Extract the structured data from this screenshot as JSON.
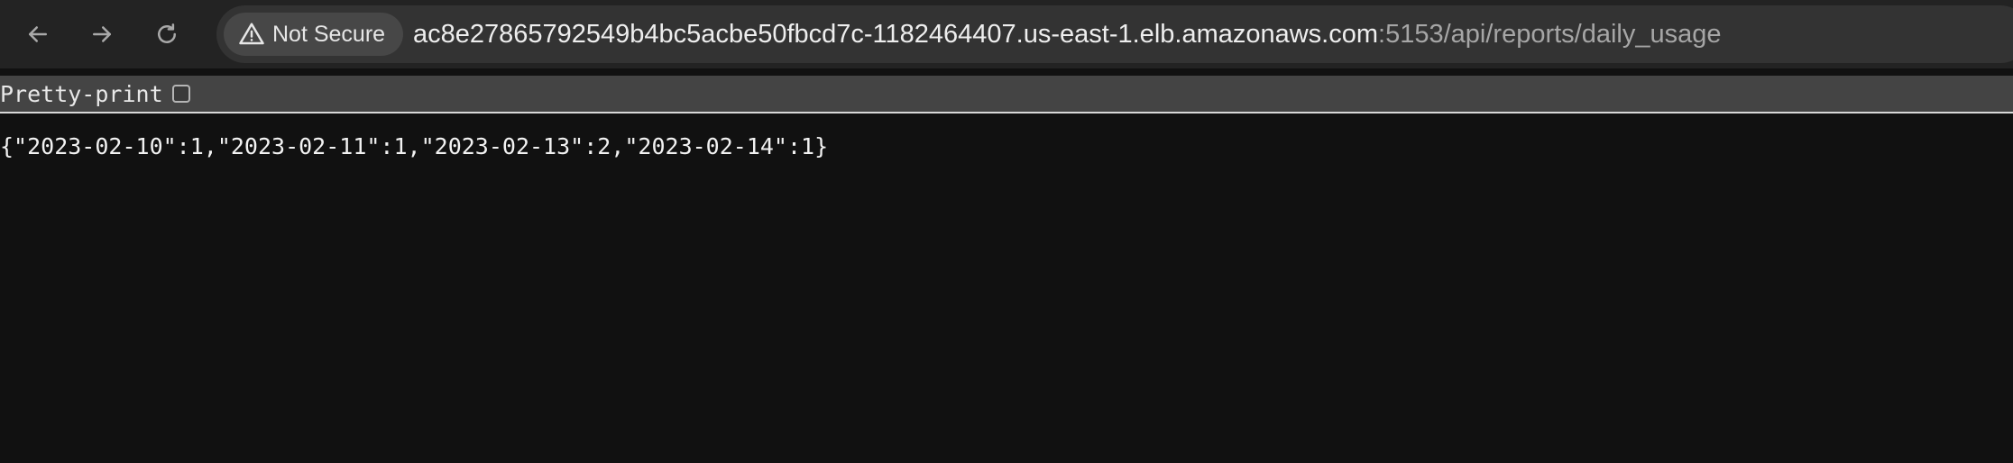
{
  "browser": {
    "back_icon": "back-arrow-icon",
    "forward_icon": "forward-arrow-icon",
    "reload_icon": "reload-icon",
    "security": {
      "icon": "warning-triangle-icon",
      "label": "Not Secure"
    },
    "url": {
      "host": "ac8e27865792549b4bc5acbe50fbcd7c-1182464407.us-east-1.elb.amazonaws.com",
      "path": ":5153/api/reports/daily_usage"
    }
  },
  "viewer": {
    "pretty_print_label": "Pretty-print",
    "pretty_print_checked": false,
    "body_text": "{\"2023-02-10\":1,\"2023-02-11\":1,\"2023-02-13\":2,\"2023-02-14\":1}"
  },
  "colors": {
    "page_bg": "#111111",
    "toolbar_bg": "#232323",
    "omnibox_bg": "#333333",
    "chip_bg": "#474747",
    "text_primary": "#eeeeee",
    "text_secondary": "#a6a6a6"
  }
}
